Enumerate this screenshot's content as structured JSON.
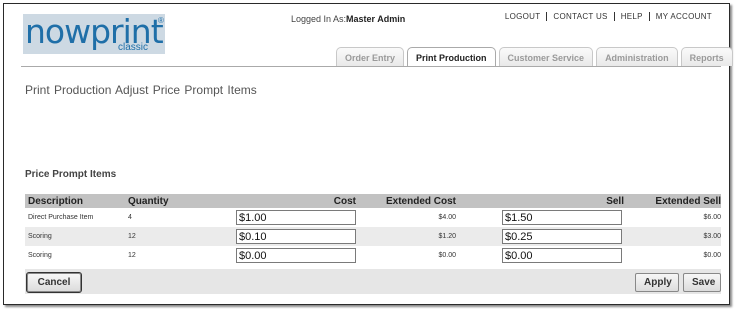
{
  "header": {
    "logo_word": "nowprint",
    "logo_reg": "®",
    "logo_sub": "classic",
    "logged_in_label": "Logged In As:",
    "logged_in_user": "Master Admin",
    "links": [
      "LOGOUT",
      "CONTACT US",
      "HELP",
      "MY ACCOUNT"
    ]
  },
  "tabs": [
    {
      "label": "Order Entry",
      "active": false
    },
    {
      "label": "Print Production",
      "active": true
    },
    {
      "label": "Customer Service",
      "active": false
    },
    {
      "label": "Administration",
      "active": false
    },
    {
      "label": "Reports",
      "active": false
    }
  ],
  "page_title": "Print Production  Adjust Price Prompt Items",
  "section_title": "Price Prompt Items",
  "table": {
    "headers": {
      "description": "Description",
      "quantity": "Quantity",
      "cost": "Cost",
      "extended_cost": "Extended Cost",
      "sell": "Sell",
      "extended_sell": "Extended Sell"
    },
    "rows": [
      {
        "description": "Direct Purchase Item",
        "quantity": "4",
        "cost": "$1.00",
        "extended_cost": "$4.00",
        "sell": "$1.50",
        "extended_sell": "$6.00"
      },
      {
        "description": "Scoring",
        "quantity": "12",
        "cost": "$0.10",
        "extended_cost": "$1.20",
        "sell": "$0.25",
        "extended_sell": "$3.00"
      },
      {
        "description": "Scoring",
        "quantity": "12",
        "cost": "$0.00",
        "extended_cost": "$0.00",
        "sell": "$0.00",
        "extended_sell": "$0.00"
      }
    ]
  },
  "buttons": {
    "cancel": "Cancel",
    "apply": "Apply",
    "save": "Save"
  },
  "colors": {
    "brand": "#1f6fa8",
    "header_row": "#c2c2c2",
    "alt_row": "#ebebeb"
  }
}
